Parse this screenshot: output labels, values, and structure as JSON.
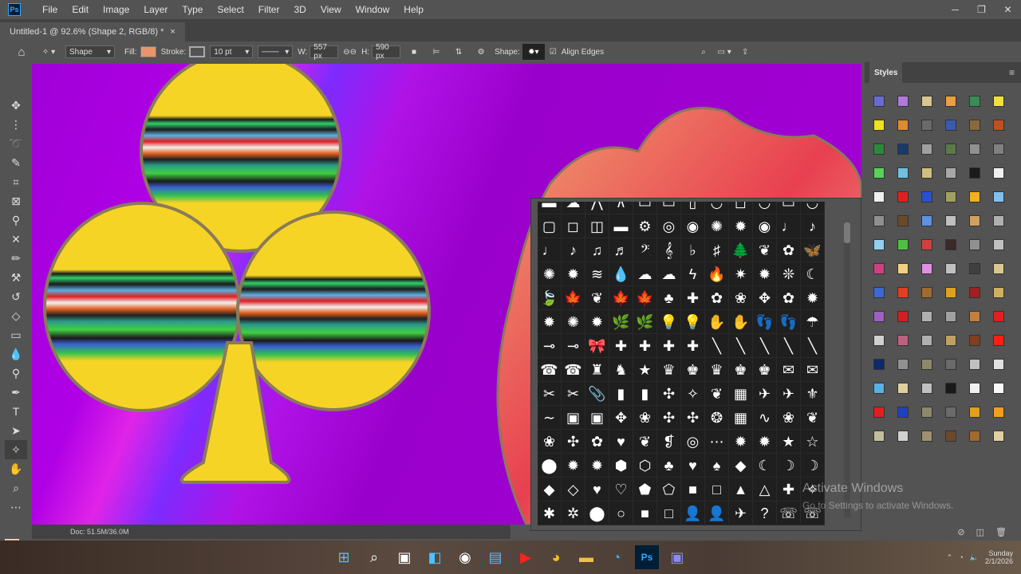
{
  "app": {
    "logo_text": "Ps"
  },
  "menu": [
    "File",
    "Edit",
    "Image",
    "Layer",
    "Type",
    "Select",
    "Filter",
    "3D",
    "View",
    "Window",
    "Help"
  ],
  "document_tab": {
    "title": "Untitled-1 @ 92.6% (Shape 2, RGB/8) *",
    "close": "×"
  },
  "options": {
    "mode": "Shape",
    "fill_label": "Fill:",
    "fill_color": "#e8956a",
    "stroke_label": "Stroke:",
    "stroke_width": "10 pt",
    "w_label": "W:",
    "w_value": "557 px",
    "h_label": "H:",
    "h_value": "590 px",
    "shape_label": "Shape:",
    "align_edges": "Align Edges"
  },
  "styles_panel": {
    "title": "Styles",
    "swatches": [
      "#6a6ad0",
      "#b07ad8",
      "#d8c890",
      "#e8a040",
      "#3a8a5a",
      "#f0e040",
      "#f0e020",
      "#e08a30",
      "#6a6a6a",
      "#3a5ab0",
      "#8a6a3a",
      "#c05020",
      "#2a8a3a",
      "#1a3a6a",
      "#a0a0a0",
      "#5a7a4a",
      "#909090",
      "#808080",
      "#5ad05a",
      "#70c0e0",
      "#d0c080",
      "#a8a8a8",
      "#1a1a1a",
      "#f0f0f0",
      "#f0f0f0",
      "#e02020",
      "#2a50d0",
      "#a0a060",
      "#f0b020",
      "#80c0f0",
      "#909090",
      "#6a4a2a",
      "#6090e0",
      "#c0c0c0",
      "#d0a060",
      "#b0b0b0",
      "#90d0f0",
      "#50c040",
      "#d04040",
      "#3a2a2a",
      "#909090",
      "#c0c0c0",
      "#d04080",
      "#f0d080",
      "#e090e0",
      "#c0c0c0",
      "#404040",
      "#d8c890",
      "#3a6ad0",
      "#e04020",
      "#a06a30",
      "#e0a020",
      "#a02020",
      "#d0b060",
      "#a060c0",
      "#d02020",
      "#b0b0b0",
      "#a0a0a0",
      "#c08040",
      "#e02020",
      "#d0d0d0",
      "#c06080",
      "#b0b0b0",
      "#c0a060",
      "#804020",
      "#ff2010",
      "#0a2a6a",
      "#909090",
      "#8a8a6a",
      "#6a6a6a",
      "#c0c0c0",
      "#e0e0e0",
      "#5ab0e0",
      "#e0d0a0",
      "#c0c0c0",
      "#1a1a1a",
      "#f0f0f0",
      "#f8f8f8",
      "#e02020",
      "#2040c0",
      "#8a8a6a",
      "#6a6a6a",
      "#e0a020",
      "#f0a020",
      "#c0c0a0",
      "#d0d0d0",
      "#a09070",
      "#6a4a2a",
      "#a06a30",
      "#e0d0a0"
    ],
    "footer": [
      "⊘",
      "◫",
      "🗑"
    ]
  },
  "shape_picker": {
    "shapes": [
      "▬",
      "☁",
      "⋀",
      "∧",
      "▭",
      "▭",
      "▯",
      "◡",
      "◻",
      "◡",
      "▭",
      "◡",
      "▢",
      "◻",
      "◫",
      "▬",
      "⚙",
      "◎",
      "◉",
      "✺",
      "✹",
      "◉",
      "♩",
      "♪",
      "♩",
      "♪",
      "♫",
      "♬",
      "𝄢",
      "𝄞",
      "♭",
      "♯",
      "🌲",
      "❦",
      "✿",
      "🦋",
      "✺",
      "✹",
      "≋",
      "💧",
      "☁",
      "☁",
      "ϟ",
      "🔥",
      "✷",
      "✹",
      "❊",
      "☾",
      "🍃",
      "🍁",
      "❦",
      "🍁",
      "🍁",
      "♣",
      "✚",
      "✿",
      "❀",
      "✥",
      "✿",
      "✹",
      "✹",
      "✺",
      "✹",
      "🌿",
      "🌿",
      "💡",
      "💡",
      "✋",
      "✋",
      "👣",
      "👣",
      "☂",
      "⊸",
      "⊸",
      "🎀",
      "✚",
      "✚",
      "✚",
      "✚",
      "╲",
      "╲",
      "╲",
      "╲",
      "╲",
      "☎",
      "☎",
      "♜",
      "♞",
      "★",
      "♛",
      "♚",
      "♛",
      "♚",
      "♚",
      "✉",
      "✉",
      "✂",
      "✂",
      "📎",
      "▮",
      "▮",
      "✣",
      "✧",
      "❦",
      "▦",
      "✈",
      "✈",
      "⚜",
      "∼",
      "▣",
      "▣",
      "✥",
      "❀",
      "✣",
      "✣",
      "❂",
      "▦",
      "∿",
      "❀",
      "❦",
      "❀",
      "✣",
      "✿",
      "♥",
      "❦",
      "❡",
      "◎",
      "⋯",
      "✹",
      "✹",
      "★",
      "☆",
      "⬤",
      "✹",
      "✹",
      "⬢",
      "⬡",
      "♣",
      "♥",
      "♠",
      "◆",
      "☾",
      "☽",
      "☽",
      "◆",
      "◇",
      "♥",
      "♡",
      "⬟",
      "⬠",
      "■",
      "□",
      "▲",
      "△",
      "✚",
      "✧",
      "✱",
      "✲",
      "⬤",
      "○",
      "■",
      "□",
      "👤",
      "👤",
      "✈",
      "?",
      "☏",
      "☏"
    ]
  },
  "status": {
    "doc": "Doc: 51.5M/36.0M"
  },
  "watermark": {
    "line1": "Activate Windows",
    "line2": "Go to Settings to activate Windows."
  },
  "taskbar": {
    "icons": [
      "windows-start",
      "search",
      "task-view",
      "widgets",
      "github",
      "store",
      "youtube",
      "chrome",
      "file-explorer",
      "edge",
      "photoshop",
      "video"
    ],
    "time": "Sunday",
    "date": "2/1/2026"
  }
}
